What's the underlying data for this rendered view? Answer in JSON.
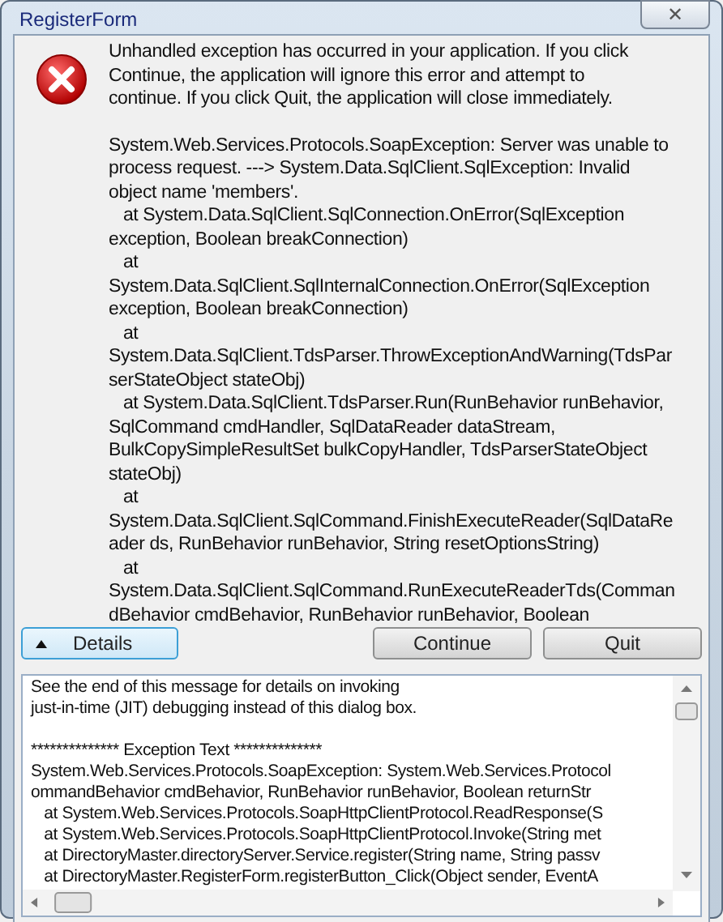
{
  "window": {
    "title": "RegisterForm",
    "close_label": "✕"
  },
  "message": [
    "Unhandled exception has occurred in your application. If you click",
    "Continue, the application will ignore this error and attempt to",
    "continue. If you click Quit, the application will close immediately."
  ],
  "details_summary": [
    "System.Web.Services.Protocols.SoapException: Server was unable to",
    "process request. ---> System.Data.SqlClient.SqlException: Invalid",
    "object name 'members'.",
    "   at System.Data.SqlClient.SqlConnection.OnError(SqlException",
    "exception, Boolean breakConnection)",
    "   at",
    "System.Data.SqlClient.SqlInternalConnection.OnError(SqlException",
    "exception, Boolean breakConnection)",
    "   at",
    "System.Data.SqlClient.TdsParser.ThrowExceptionAndWarning(TdsPar",
    "serStateObject stateObj)",
    "   at System.Data.SqlClient.TdsParser.Run(RunBehavior runBehavior,",
    "SqlCommand cmdHandler, SqlDataReader dataStream,",
    "BulkCopySimpleResultSet bulkCopyHandler, TdsParserStateObject",
    "stateObj)",
    "   at",
    "System.Data.SqlClient.SqlCommand.FinishExecuteReader(SqlDataRe",
    "ader ds, RunBehavior runBehavior, String resetOptionsString)",
    "   at",
    "System.Data.SqlClient.SqlCommand.RunExecuteReaderTds(Comman",
    "dBehavior cmdBehavior, RunBehavior runBehavior, Boolean"
  ],
  "buttons": [
    {
      "kind": "toggle",
      "label": "Details",
      "expanded": true
    },
    {
      "kind": "plain",
      "label": "Continue"
    },
    {
      "kind": "plain",
      "label": "Quit"
    }
  ],
  "details_box": {
    "intro": [
      "See the end of this message for details on invoking",
      "just-in-time (JIT) debugging instead of this dialog box."
    ],
    "exception": [
      "************** Exception Text **************",
      "System.Web.Services.Protocols.SoapException: System.Web.Services.Protocol",
      "ommandBehavior cmdBehavior, RunBehavior runBehavior, Boolean returnStr",
      "   at System.Web.Services.Protocols.SoapHttpClientProtocol.ReadResponse(S",
      "   at System.Web.Services.Protocols.SoapHttpClientProtocol.Invoke(String met",
      "   at DirectoryMaster.directoryServer.Service.register(String name, String passv",
      "   at DirectoryMaster.RegisterForm.registerButton_Click(Object sender, EventA"
    ]
  }
}
